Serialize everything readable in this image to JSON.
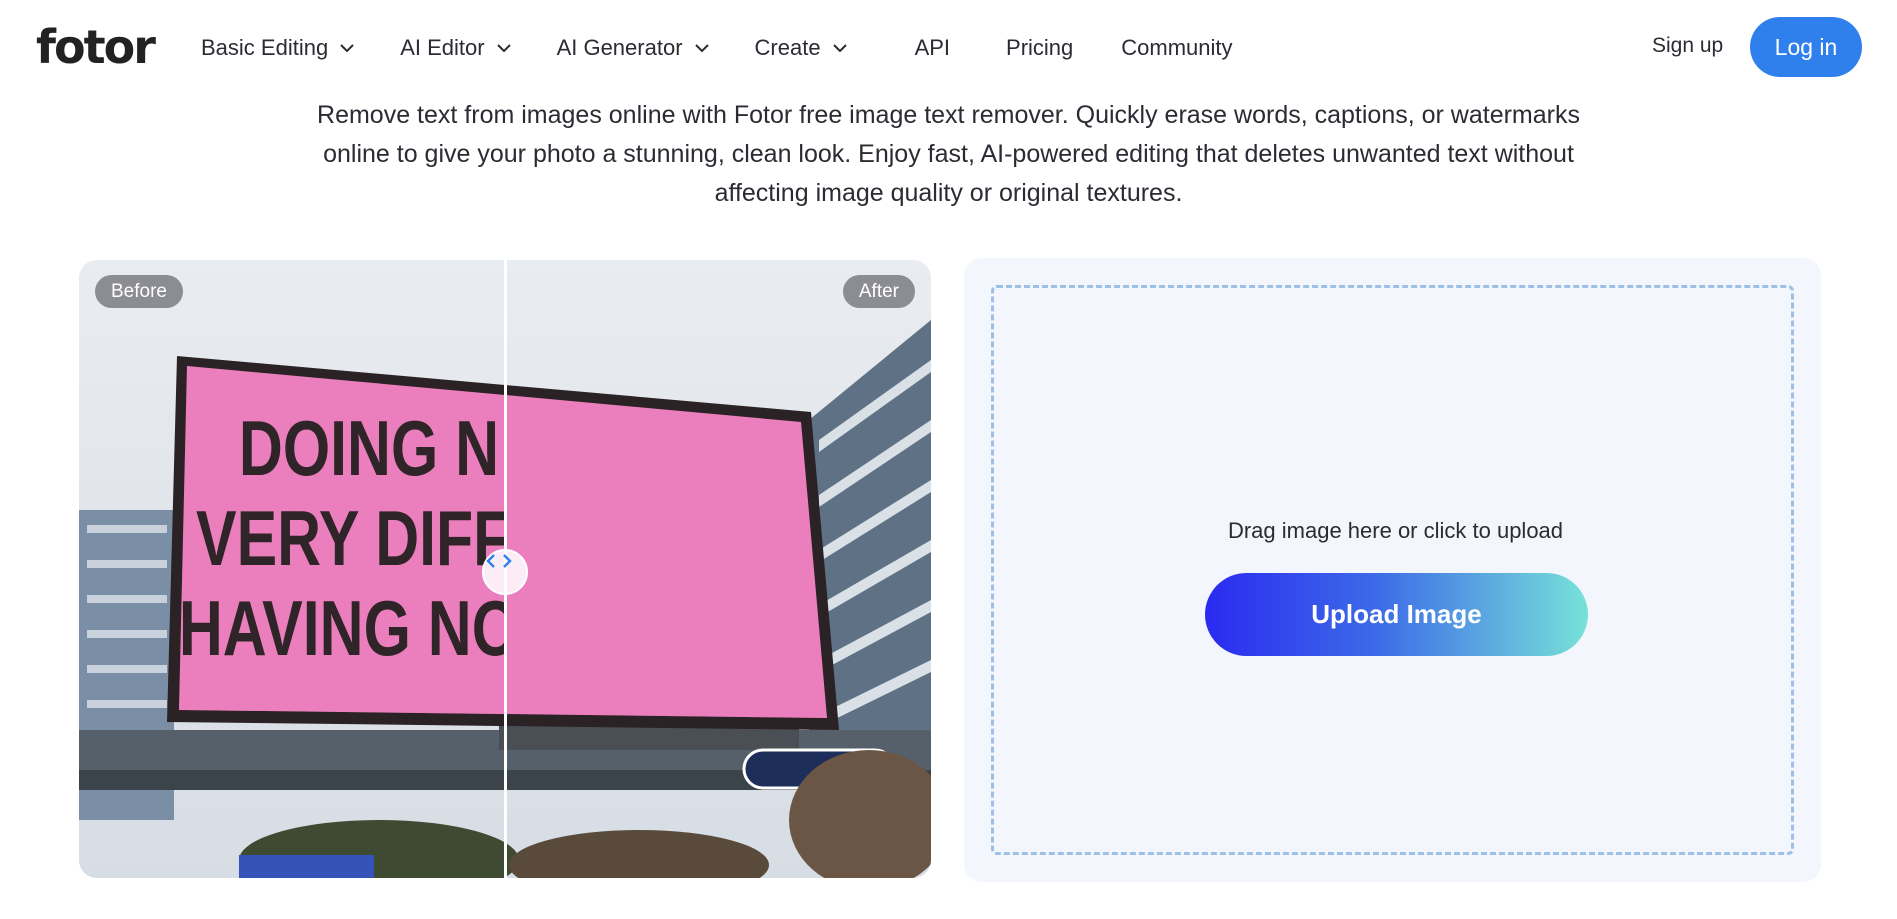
{
  "brand": {
    "logo_text": "fotor",
    "accent": "#2f80ed"
  },
  "nav": {
    "items": [
      {
        "label": "Basic Editing",
        "has_dropdown": true
      },
      {
        "label": "AI Editor",
        "has_dropdown": true
      },
      {
        "label": "AI Generator",
        "has_dropdown": true
      },
      {
        "label": "Create",
        "has_dropdown": true
      },
      {
        "label": "API",
        "has_dropdown": false
      },
      {
        "label": "Pricing",
        "has_dropdown": false
      },
      {
        "label": "Community",
        "has_dropdown": false
      }
    ],
    "signup_label": "Sign up",
    "login_label": "Log in"
  },
  "hero": {
    "description": "Remove text from images online with Fotor free image text remover. Quickly erase words, captions, or watermarks online to give your photo a stunning, clean look. Enjoy fast, AI-powered editing that deletes unwanted text without affecting image quality or original textures."
  },
  "compare": {
    "before_label": "Before",
    "after_label": "After",
    "billboard_lines": [
      "DOING N",
      "VERY DIFF",
      "HAVING NO"
    ],
    "billboard_color": "#e879b9",
    "slider_position": 0.5
  },
  "upload": {
    "drop_text": "Drag image here or click to upload",
    "button_label": "Upload Image"
  }
}
